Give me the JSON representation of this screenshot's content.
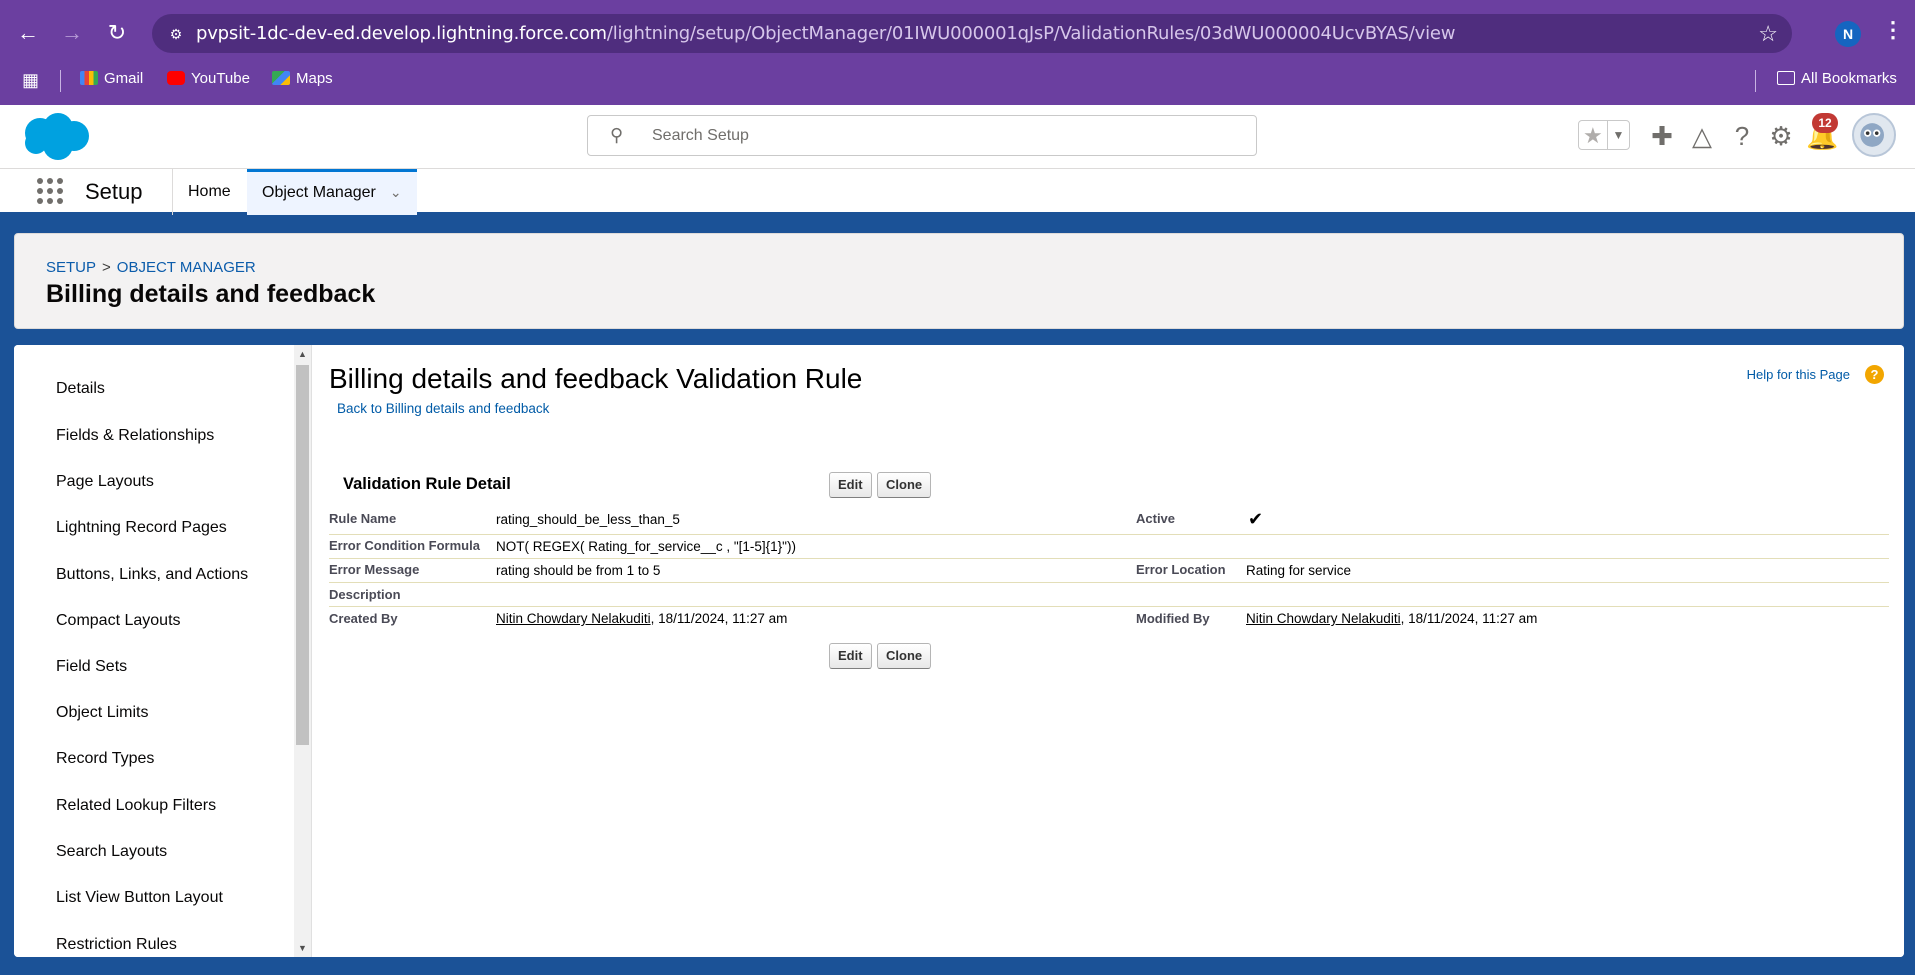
{
  "browser": {
    "url_host": "pvpsit-1dc-dev-ed.develop.lightning.force.com",
    "url_path": "/lightning/setup/ObjectManager/01IWU000001qJsP/ValidationRules/03dWU000004UcvBYAS/view",
    "profile_initial": "N",
    "bookmarks": [
      "Gmail",
      "YouTube",
      "Maps"
    ],
    "all_bookmarks": "All Bookmarks",
    "icons": {
      "back": "arrow-left-icon",
      "forward": "arrow-right-icon",
      "reload": "reload-icon",
      "star": "star-icon",
      "apps": "apps-grid-icon",
      "folder": "folder-icon"
    }
  },
  "sf_header": {
    "search_placeholder": "Search Setup",
    "notification_count": "12",
    "colors": {
      "brand": "#00a1e0",
      "badge": "#c23934"
    }
  },
  "context_bar": {
    "app_name": "Setup",
    "tabs": [
      {
        "label": "Home"
      },
      {
        "label": "Object Manager"
      }
    ]
  },
  "page_header": {
    "breadcrumb": [
      "SETUP",
      "OBJECT MANAGER"
    ],
    "title": "Billing details and feedback"
  },
  "left_nav": {
    "items": [
      "Details",
      "Fields & Relationships",
      "Page Layouts",
      "Lightning Record Pages",
      "Buttons, Links, and Actions",
      "Compact Layouts",
      "Field Sets",
      "Object Limits",
      "Record Types",
      "Related Lookup Filters",
      "Search Layouts",
      "List View Button Layout",
      "Restriction Rules"
    ]
  },
  "content": {
    "title": "Billing details and feedback Validation Rule",
    "back_link": "Back to Billing details and feedback",
    "help_link": "Help for this Page",
    "detail_section": {
      "title": "Validation Rule Detail",
      "edit_label": "Edit",
      "clone_label": "Clone",
      "fields": {
        "rule_name_label": "Rule Name",
        "rule_name_value": "rating_should_be_less_than_5",
        "active_label": "Active",
        "active_value": true,
        "formula_label": "Error Condition Formula",
        "formula_value": "NOT( REGEX( Rating_for_service__c , \"[1-5]{1}\"))",
        "error_message_label": "Error Message",
        "error_message_value": "rating should be from 1 to 5",
        "error_location_label": "Error Location",
        "error_location_value": "Rating for service",
        "description_label": "Description",
        "description_value": "",
        "created_by_label": "Created By",
        "created_by_user": "Nitin Chowdary Nelakuditi",
        "created_by_date": ", 18/11/2024, 11:27 am",
        "modified_by_label": "Modified By",
        "modified_by_user": "Nitin Chowdary Nelakuditi",
        "modified_by_date": ", 18/11/2024, 11:27 am"
      }
    }
  }
}
